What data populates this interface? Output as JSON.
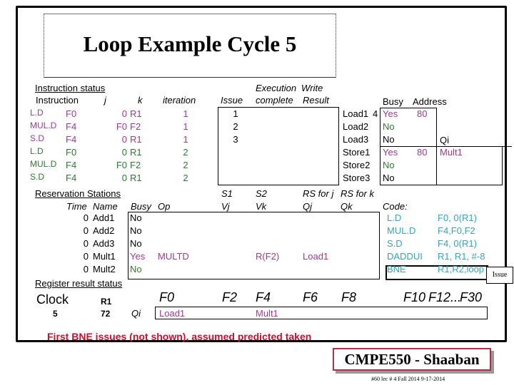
{
  "title": "Loop Example Cycle 5",
  "instruction_status": {
    "heading": "Instruction status",
    "headers": {
      "instruction": "Instruction",
      "j": "j",
      "k": "k",
      "iteration": "iteration",
      "issue": "Issue",
      "exec_top": "Execution",
      "exec_bottom": "complete",
      "write_top": "Write",
      "write_bottom": "Result"
    },
    "rows": [
      {
        "op": "L.D",
        "dest": "F0",
        "j": "0",
        "k": "R1",
        "iteration": "1",
        "issue": "1",
        "exec": "",
        "write": "",
        "color": "#a03a90"
      },
      {
        "op": "MUL.D",
        "dest": "F4",
        "j": "F0",
        "k": "F2",
        "iteration": "1",
        "issue": "2",
        "exec": "",
        "write": "",
        "color": "#a03a90"
      },
      {
        "op": "S.D",
        "dest": "F4",
        "j": "0",
        "k": "R1",
        "iteration": "1",
        "issue": "3",
        "exec": "",
        "write": "",
        "color": "#a03a90"
      },
      {
        "op": "L.D",
        "dest": "F0",
        "j": "0",
        "k": "R1",
        "iteration": "2",
        "issue": "",
        "exec": "",
        "write": "",
        "color": "#2e7a35"
      },
      {
        "op": "MUL.D",
        "dest": "F4",
        "j": "F0",
        "k": "F2",
        "iteration": "2",
        "issue": "",
        "exec": "",
        "write": "",
        "color": "#2e7a35"
      },
      {
        "op": "S.D",
        "dest": "F4",
        "j": "0",
        "k": "R1",
        "iteration": "2",
        "issue": "",
        "exec": "",
        "write": "",
        "color": "#2e7a35"
      }
    ]
  },
  "load_store_buffers": {
    "headers": {
      "busy": "Busy",
      "address": "Address",
      "qi": "Qi"
    },
    "rows": [
      {
        "name": "Load1",
        "extra": "4",
        "busy": "Yes",
        "address": "80",
        "qi": ""
      },
      {
        "name": "Load2",
        "extra": "",
        "busy": "No",
        "address": "",
        "qi": ""
      },
      {
        "name": "Load3",
        "extra": "",
        "busy": "No",
        "address": "",
        "qi": ""
      },
      {
        "name": "Store1",
        "extra": "",
        "busy": "Yes",
        "address": "80",
        "qi": "Mult1"
      },
      {
        "name": "Store2",
        "extra": "",
        "busy": "No",
        "address": "",
        "qi": ""
      },
      {
        "name": "Store3",
        "extra": "",
        "busy": "No",
        "address": "",
        "qi": ""
      }
    ]
  },
  "reservation_stations": {
    "heading": "Reservation Stations",
    "headers": {
      "time": "Time",
      "name": "Name",
      "busy": "Busy",
      "op": "Op",
      "s1": "S1",
      "s2": "S2",
      "rsj": "RS for j",
      "rsk": "RS for k",
      "vj": "Vj",
      "vk": "Vk",
      "qj": "Qj",
      "qk": "Qk"
    },
    "rows": [
      {
        "time": "0",
        "name": "Add1",
        "busy": "No",
        "op": "",
        "vj": "",
        "vk": "",
        "qj": "",
        "qk": ""
      },
      {
        "time": "0",
        "name": "Add2",
        "busy": "No",
        "op": "",
        "vj": "",
        "vk": "",
        "qj": "",
        "qk": ""
      },
      {
        "time": "0",
        "name": "Add3",
        "busy": "No",
        "op": "",
        "vj": "",
        "vk": "",
        "qj": "",
        "qk": ""
      },
      {
        "time": "0",
        "name": "Mult1",
        "busy": "Yes",
        "op": "MULTD",
        "vj": "",
        "vk": "R(F2)",
        "qj": "Load1",
        "qk": ""
      },
      {
        "time": "0",
        "name": "Mult2",
        "busy": "No",
        "op": "",
        "vj": "",
        "vk": "",
        "qj": "",
        "qk": ""
      }
    ]
  },
  "code": {
    "heading": "Code:",
    "lines": [
      {
        "op": "L.D",
        "args": "F0, 0(R1)"
      },
      {
        "op": "MUL.D",
        "args": "F4,F0,F2"
      },
      {
        "op": "S.D",
        "args": "F4, 0(R1)"
      },
      {
        "op": "DADDUI",
        "args": "R1, R1, #-8"
      },
      {
        "op": "BNE",
        "args": "R1,R2,loop"
      }
    ],
    "issue_tag": "Issue"
  },
  "register_status": {
    "heading": "Register result status",
    "clock_label": "Clock",
    "clock_value": "5",
    "r1_label": "R1",
    "r1_value": "72",
    "qi_label": "Qi",
    "registers": [
      "F0",
      "F2",
      "F4",
      "F6",
      "F8",
      "F10",
      "F12...",
      "F30"
    ],
    "qi_values": [
      "Load1",
      "",
      "Mult1",
      "",
      "",
      "",
      "",
      ""
    ]
  },
  "note": "First  BNE  issues  (not shown), assumed predicted taken",
  "footer": {
    "course": "CMPE550 - Shaaban",
    "footnote": "#60   lec # 4 Fall 2014    9-17-2014"
  }
}
